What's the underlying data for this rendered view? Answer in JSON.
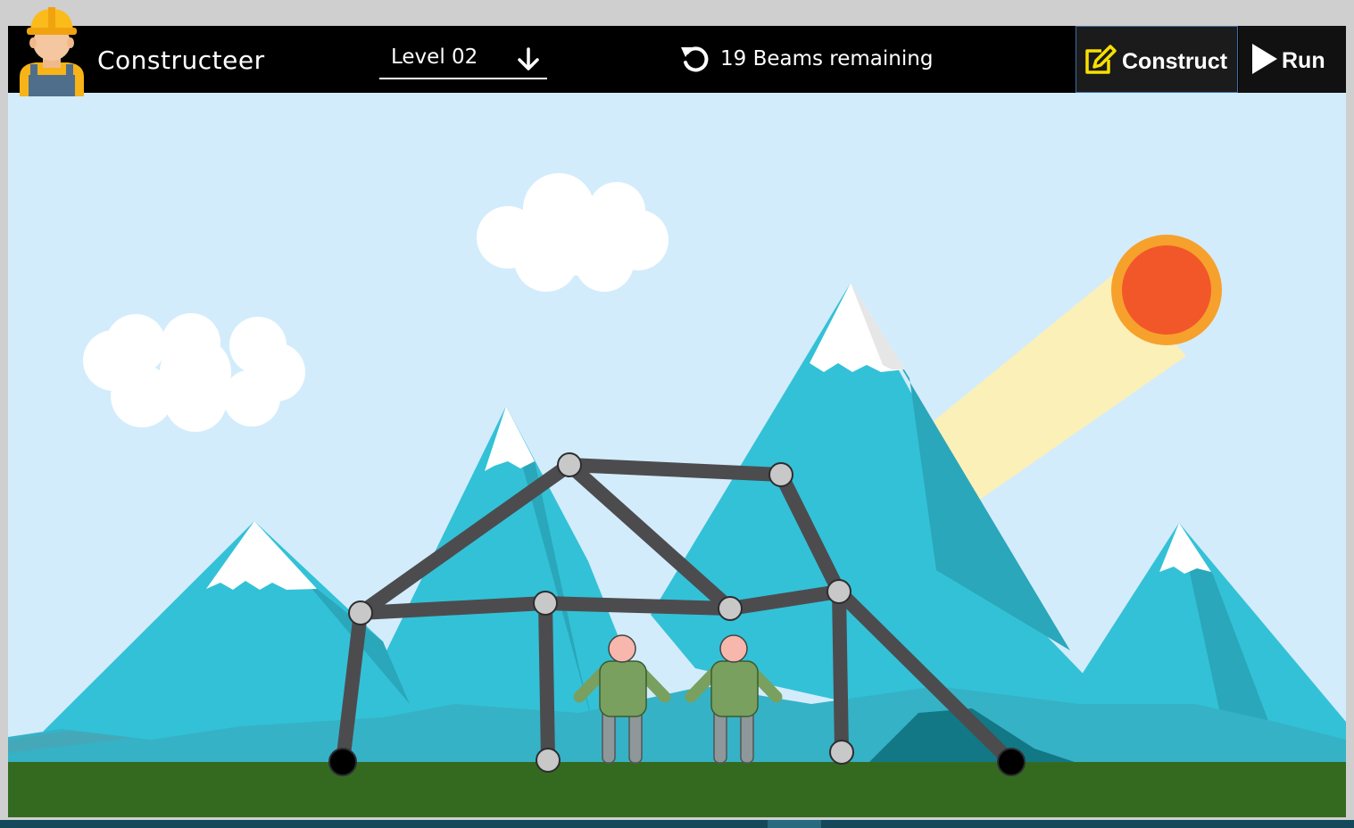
{
  "app": {
    "title": "Constructeer"
  },
  "toolbar": {
    "level_label": "Level 02",
    "beams_remaining_label": "19 Beams remaining",
    "construct_label": "Construct",
    "run_label": "Run"
  },
  "icons": {
    "level_dropdown": "arrow-down-icon",
    "reset": "reset-icon",
    "construct": "edit-icon",
    "run": "play-icon",
    "avatar": "worker-avatar"
  },
  "colors": {
    "sky": "#d3ecfb",
    "ground": "#346a20",
    "beam": "#4c4c4f",
    "joint": "#c8c8c8",
    "anchor": "#000000",
    "sun": "#f2572a",
    "sun_ring": "#f7a12d",
    "construct_icon": "#f8e000"
  }
}
